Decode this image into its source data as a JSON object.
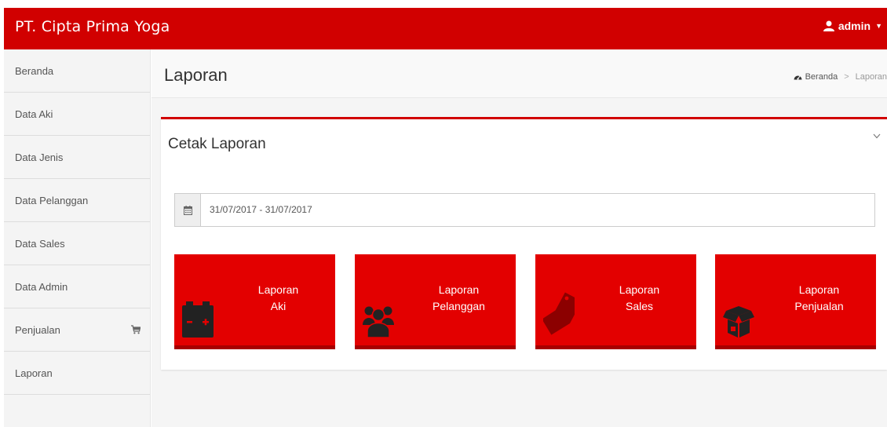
{
  "app": {
    "brand": "PT. Cipta Prima Yoga",
    "user": "admin"
  },
  "sidebar": {
    "items": [
      {
        "label": "Beranda"
      },
      {
        "label": "Data Aki"
      },
      {
        "label": "Data Jenis"
      },
      {
        "label": "Data Pelanggan"
      },
      {
        "label": "Data Sales"
      },
      {
        "label": "Data Admin"
      },
      {
        "label": "Penjualan",
        "icon": "cart-icon"
      },
      {
        "label": "Laporan"
      }
    ]
  },
  "header": {
    "title": "Laporan",
    "breadcrumb": {
      "home": "Beranda",
      "current": "Laporan"
    }
  },
  "box": {
    "title": "Cetak Laporan",
    "date_range": "31/07/2017 - 31/07/2017"
  },
  "tiles": [
    {
      "line1": "Laporan",
      "line2": "Aki",
      "icon": "battery-icon"
    },
    {
      "line1": "Laporan",
      "line2": "Pelanggan",
      "icon": "users-icon"
    },
    {
      "line1": "Laporan",
      "line2": "Sales",
      "icon": "tag-icon"
    },
    {
      "line1": "Laporan",
      "line2": "Penjualan",
      "icon": "box-icon"
    }
  ],
  "colors": {
    "primary": "#d10000",
    "tile": "#e30000",
    "tile_border": "#a80000"
  }
}
